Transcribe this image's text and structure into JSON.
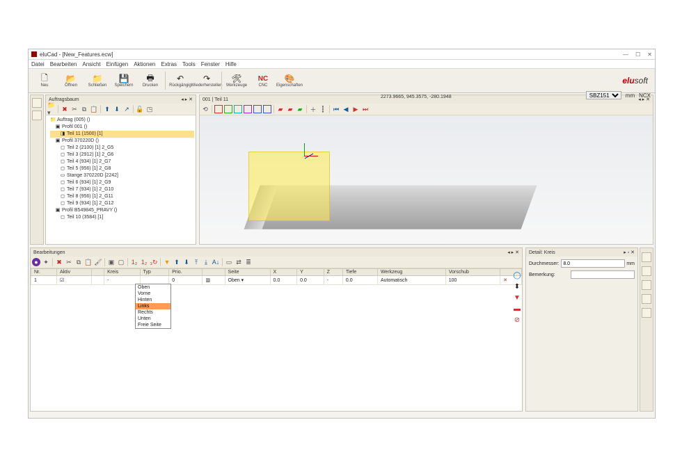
{
  "window": {
    "title": "eluCad - [New_Features.ecw]"
  },
  "menus": [
    "Datei",
    "Bearbeiten",
    "Ansicht",
    "Einfügen",
    "Aktionen",
    "Extras",
    "Tools",
    "Fenster",
    "Hilfe"
  ],
  "toolbar": [
    {
      "id": "new",
      "label": "Neu",
      "glyph": "🗋"
    },
    {
      "id": "open",
      "label": "Öffnen",
      "glyph": "📂"
    },
    {
      "id": "close",
      "label": "Schließen",
      "glyph": "📁"
    },
    {
      "id": "save",
      "label": "Speichern",
      "glyph": "💾"
    },
    {
      "id": "print",
      "label": "Drucken",
      "glyph": "🖶"
    },
    {
      "id": "undo",
      "label": "Rückgängig",
      "glyph": "↶"
    },
    {
      "id": "redo",
      "label": "Wiederherstellen",
      "glyph": "↷"
    },
    {
      "id": "tools",
      "label": "Werkzeuge",
      "glyph": "🛠"
    },
    {
      "id": "cnc",
      "label": "CNC",
      "glyph": "NC",
      "nc": true
    },
    {
      "id": "props",
      "label": "Eigenschaften",
      "glyph": "🎨"
    }
  ],
  "status": {
    "machine": "SBZ151",
    "unit": "mm",
    "format": "NCX"
  },
  "auftragsbaum": {
    "title": "Auftragsbaum",
    "tree": [
      {
        "l": 0,
        "t": "Auftrag (005) ()",
        "ico": "📁"
      },
      {
        "l": 1,
        "t": "Profil 001 ()",
        "ico": "▣"
      },
      {
        "l": 2,
        "t": "Teil 11 (1500) [1]",
        "ico": "◨",
        "sel": true
      },
      {
        "l": 1,
        "t": "Profil 370220D ()",
        "ico": "▣"
      },
      {
        "l": 2,
        "t": "Teil 2 (2100) [1]  2_G5",
        "ico": "◻"
      },
      {
        "l": 2,
        "t": "Teil 3 (2912) [1]  2_G6",
        "ico": "◻"
      },
      {
        "l": 2,
        "t": "Teil 4 (934) [1]  2_G7",
        "ico": "◻"
      },
      {
        "l": 2,
        "t": "Teil 5 (956) [1]  2_G8",
        "ico": "◻"
      },
      {
        "l": 2,
        "t": "Stange 370220D [2242]",
        "ico": "▭"
      },
      {
        "l": 2,
        "t": "Teil 6 (934) [1]  2_G9",
        "ico": "◻"
      },
      {
        "l": 2,
        "t": "Teil 7 (934) [1]  2_G10",
        "ico": "◻"
      },
      {
        "l": 2,
        "t": "Teil 8 (956) [1]  2_G11",
        "ico": "◻"
      },
      {
        "l": 2,
        "t": "Teil 9 (934) [1]  2_G12",
        "ico": "◻"
      },
      {
        "l": 1,
        "t": "Profil B549845_PRAVY ()",
        "ico": "▣"
      },
      {
        "l": 2,
        "t": "Teil 10 (3584) [1]",
        "ico": "◻"
      }
    ]
  },
  "view": {
    "title": "001 | Teil 11",
    "coords": "2273.9665, 945.3575, -280.1948"
  },
  "bearbeitungen": {
    "title": "Bearbeitungen",
    "columns": [
      "Nr.",
      "Aktiv",
      "",
      "Kreis",
      "Typ",
      "Prio.",
      "",
      "Seite",
      "X",
      "Y",
      "Z",
      "Tiefe",
      "Werkzeug",
      "Vorschub",
      ""
    ],
    "row": {
      "nr": "1",
      "aktiv": "☑",
      "kreis": "-",
      "typ": "",
      "prio": "0",
      "seite": "Oben",
      "x": "0.0",
      "y": "0.0",
      "z": "-",
      "tiefe": "0.0",
      "werkzeug": "Automatisch",
      "vorschub": "100",
      "del": "✕"
    },
    "dropdown": {
      "options": [
        "Oben",
        "Vorne",
        "Hinten",
        "Links",
        "Rechts",
        "Unten",
        "Freie Seite"
      ],
      "highlight": "Links"
    }
  },
  "detail": {
    "title": "Detail: Kreis",
    "durchmesser_label": "Durchmesser:",
    "durchmesser_value": "8.0",
    "durchmesser_unit": "mm",
    "bemerkung_label": "Bemerkung:",
    "bemerkung_value": ""
  },
  "colors": {
    "accent": "#ff9b57"
  }
}
